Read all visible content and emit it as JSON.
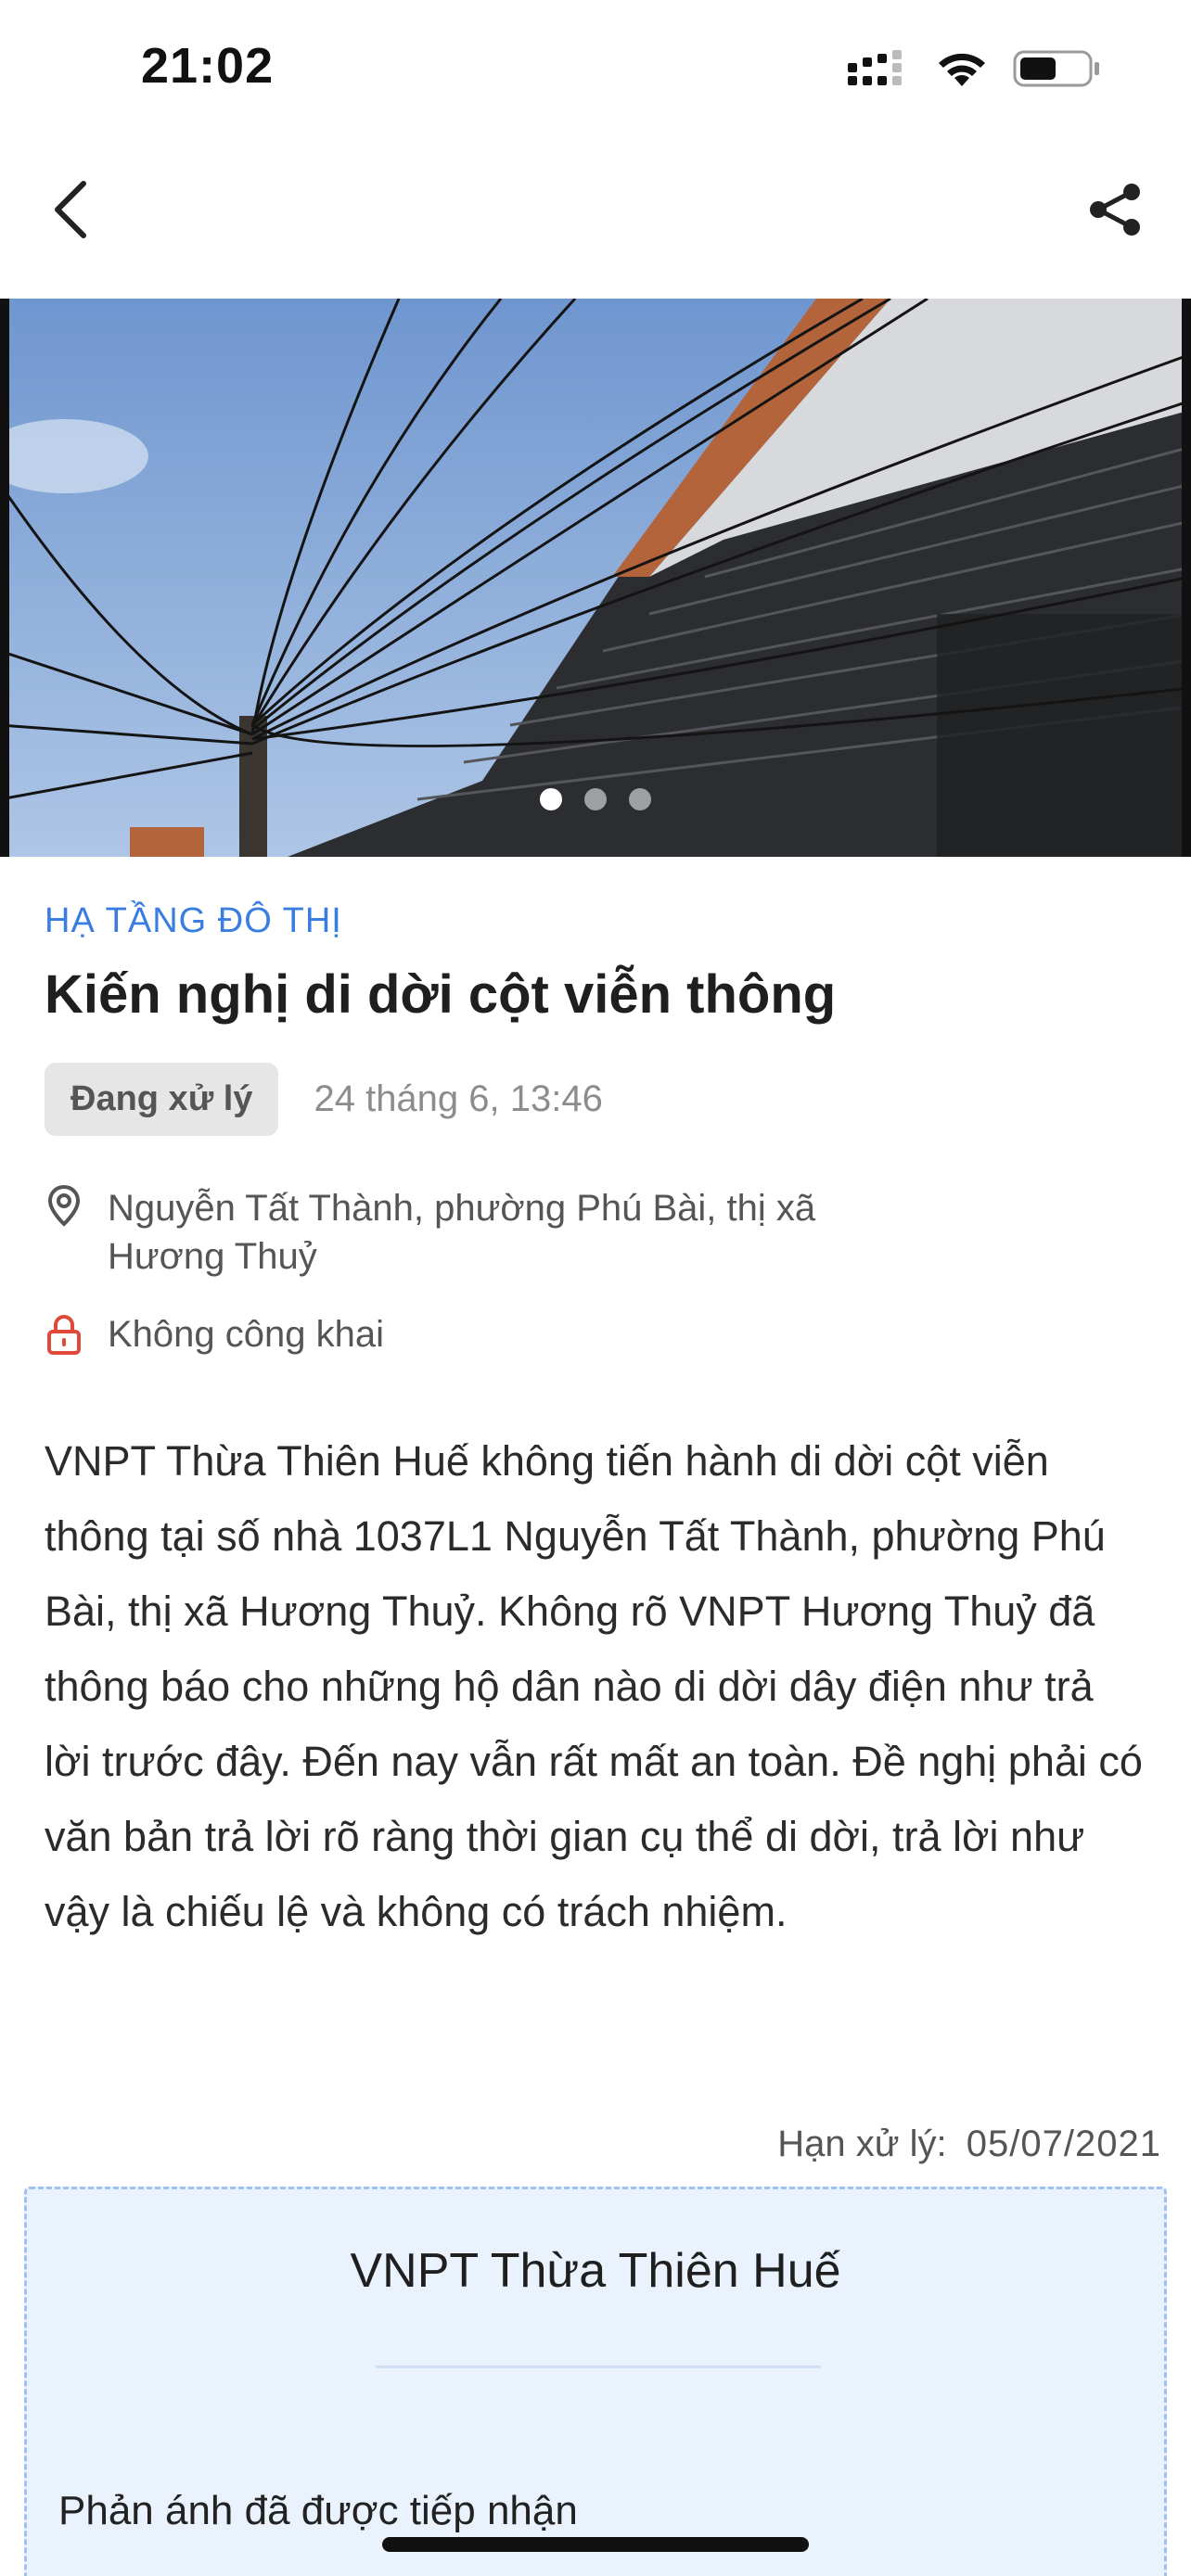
{
  "status_bar": {
    "time": "21:02",
    "icons": [
      "signal-icon",
      "wifi-icon",
      "battery-icon"
    ]
  },
  "nav": {
    "back_icon": "chevron-left-icon",
    "share_icon": "share-icon"
  },
  "gallery": {
    "page_count": 3,
    "active_index": 0
  },
  "report": {
    "category": "HẠ TẦNG ĐÔ THỊ",
    "title": "Kiến nghị di dời cột viễn thông",
    "status": "Đang xử lý",
    "datetime": "24 tháng 6, 13:46",
    "address": "Nguyễn Tất Thành, phường Phú Bài, thị xã Hương Thuỷ",
    "visibility": "Không công khai",
    "description": "VNPT Thừa Thiên Huế không tiến hành di dời cột viễn thông tại số nhà 1037L1 Nguyễn Tất Thành, phường Phú Bài, thị xã Hương Thuỷ. Không rõ VNPT Hương Thuỷ đã thông báo cho những hộ dân nào di dời dây điện như trả lời trước đây. Đến nay vẫn rất mất an toàn. Đề nghị phải có văn bản trả lời rõ ràng thời gian cụ thể di dời, trả lời như vậy là chiếu lệ và không có trách nhiệm.",
    "deadline_label": "Hạn xử lý:",
    "deadline_value": "05/07/2021"
  },
  "response": {
    "organization": "VNPT Thừa Thiên Huế",
    "message": "Phản ánh đã được tiếp nhận"
  },
  "colors": {
    "accent": "#3a7de0",
    "status_pill_bg": "#e6e6e6",
    "lock_red": "#e0483a",
    "response_bg": "#eaf2fd",
    "response_border": "#9ec2ee"
  }
}
